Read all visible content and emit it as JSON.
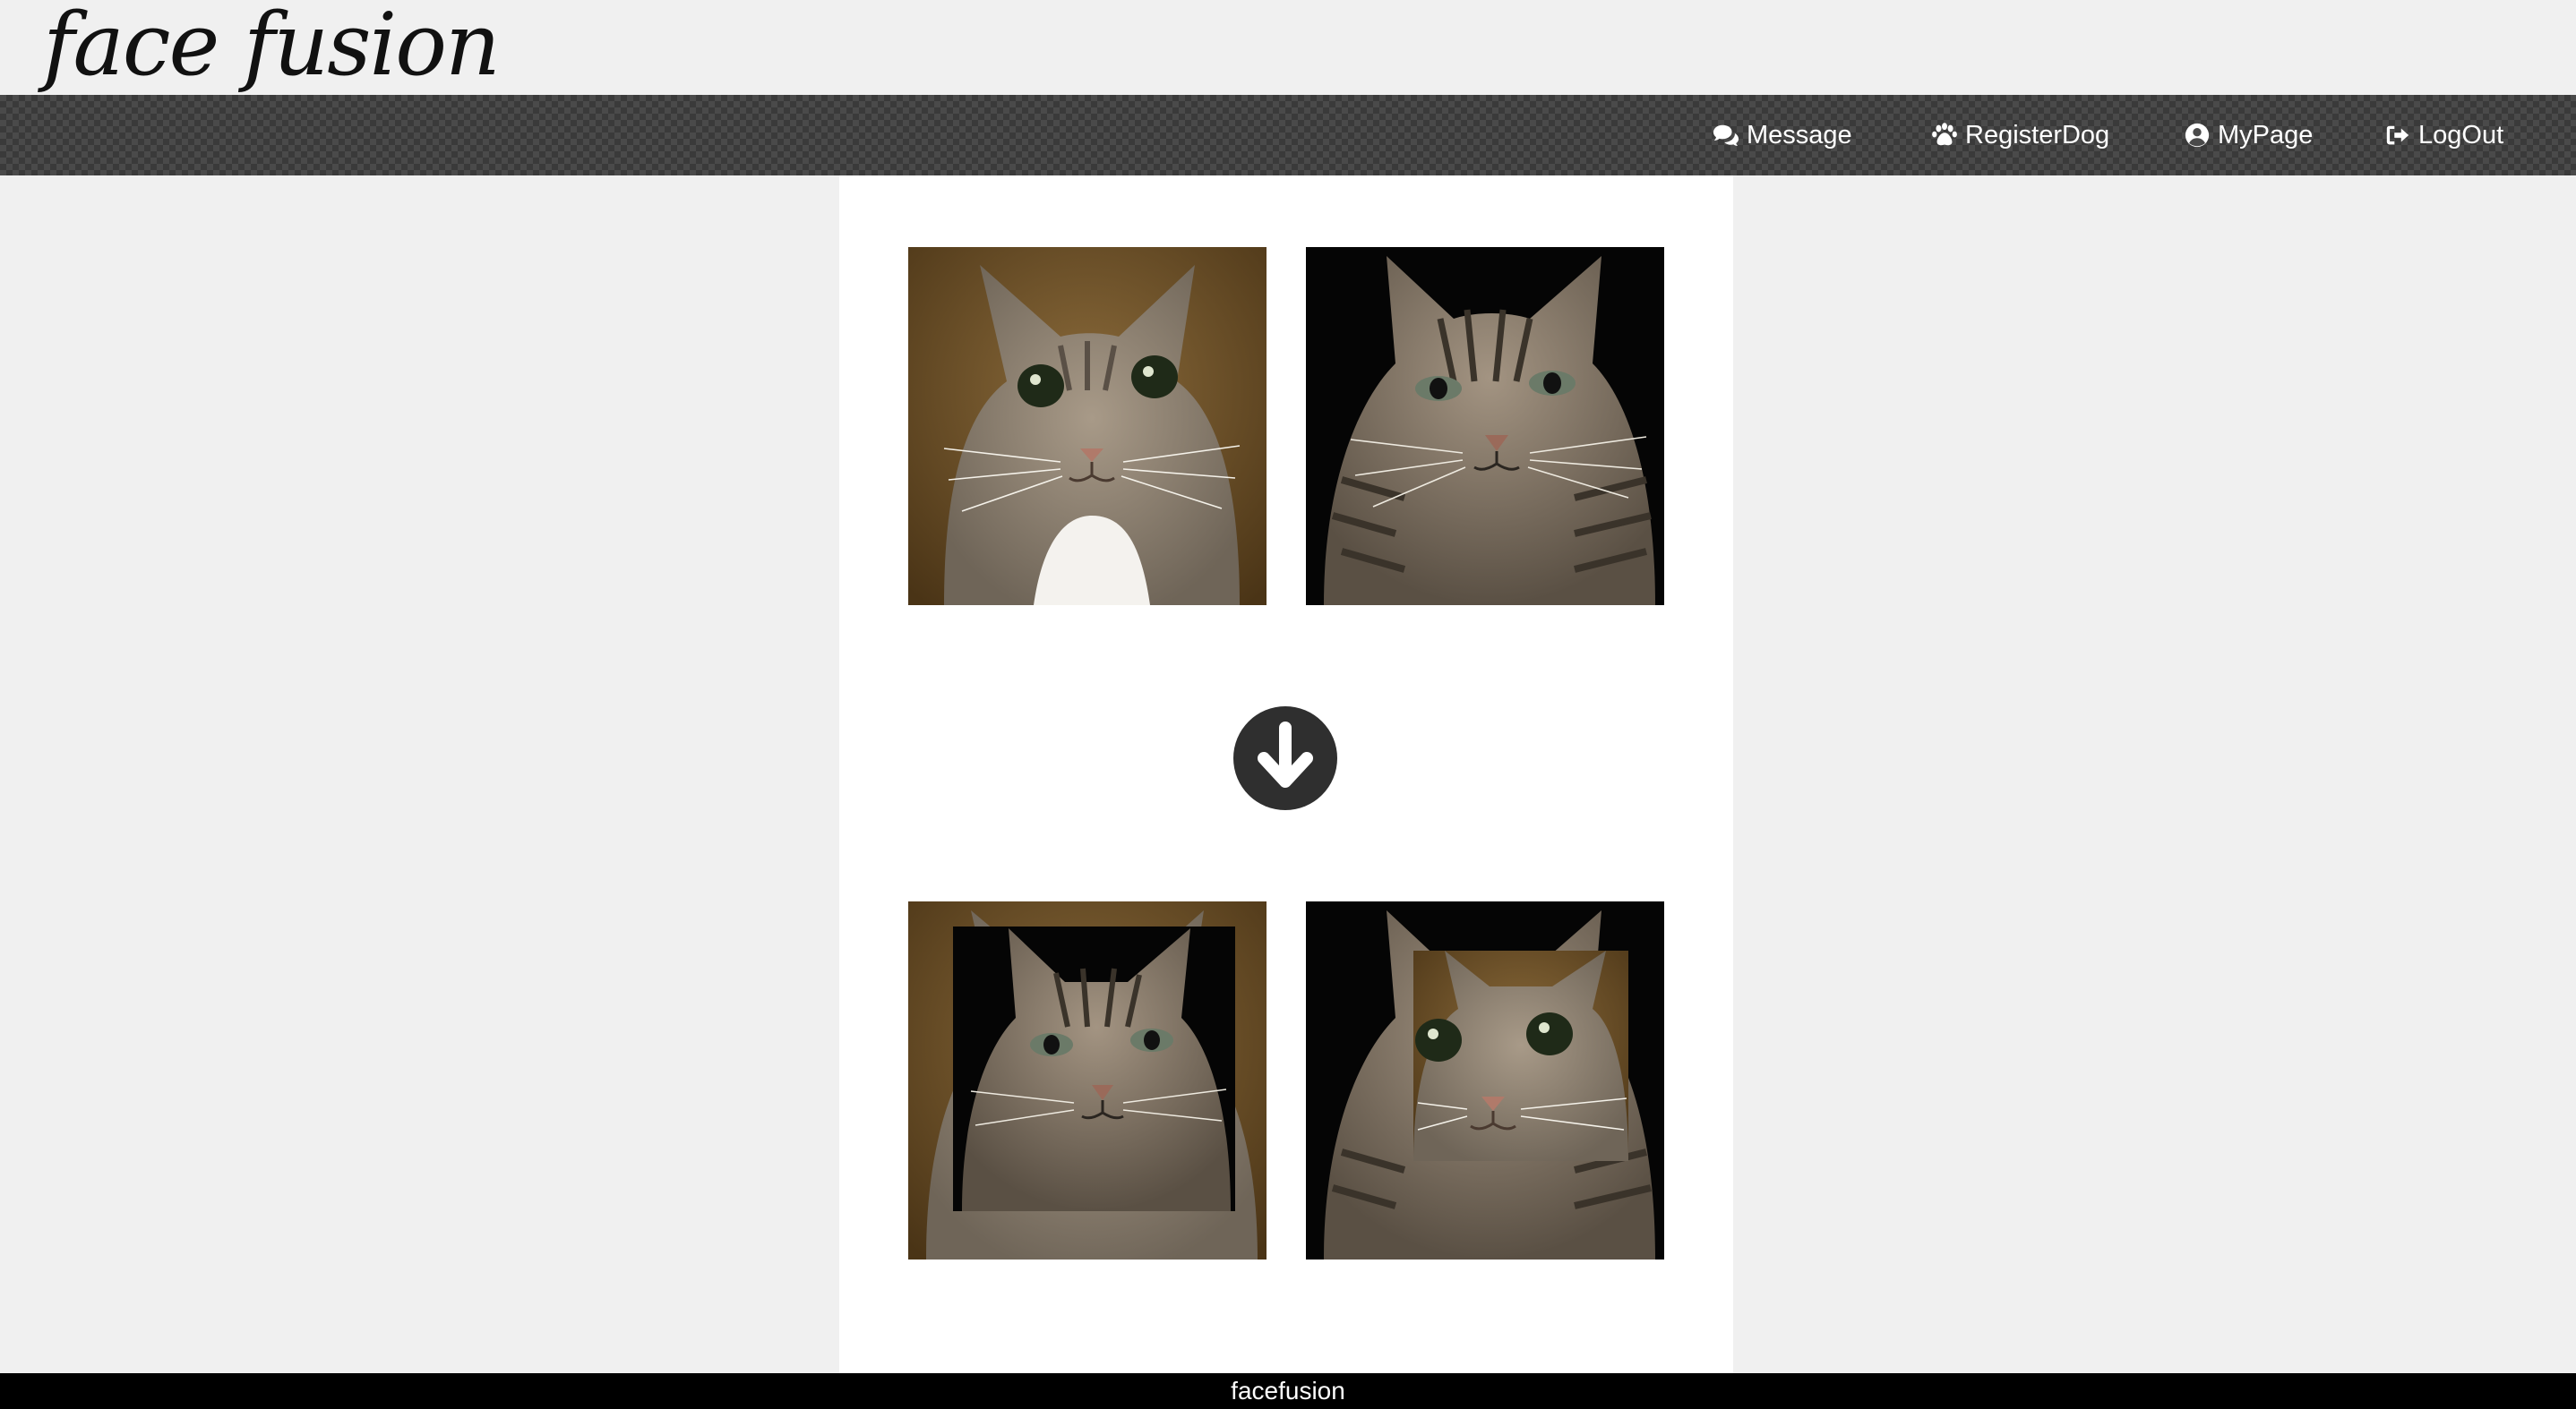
{
  "header": {
    "logo_text": "face fusion"
  },
  "nav": {
    "items": [
      {
        "label": "Message",
        "icon": "comments-icon"
      },
      {
        "label": "RegisterDog",
        "icon": "paw-icon"
      },
      {
        "label": "MyPage",
        "icon": "user-circle-icon"
      },
      {
        "label": "LogOut",
        "icon": "sign-out-icon"
      }
    ]
  },
  "main": {
    "source_images": [
      {
        "subject": "tabby cat with white chest, brown background"
      },
      {
        "subject": "striped tabby cat, black background"
      }
    ],
    "action_icon": "arrow-circle-down-icon",
    "result_images": [
      {
        "subject": "cat 1 with face of cat 2"
      },
      {
        "subject": "cat 2 with face of cat 1"
      }
    ]
  },
  "footer": {
    "text": "facefusion"
  },
  "colors": {
    "navbar": "#4a4a4a",
    "footer": "#000000",
    "page_bg": "#f0f0f0",
    "panel_bg": "#ffffff"
  }
}
